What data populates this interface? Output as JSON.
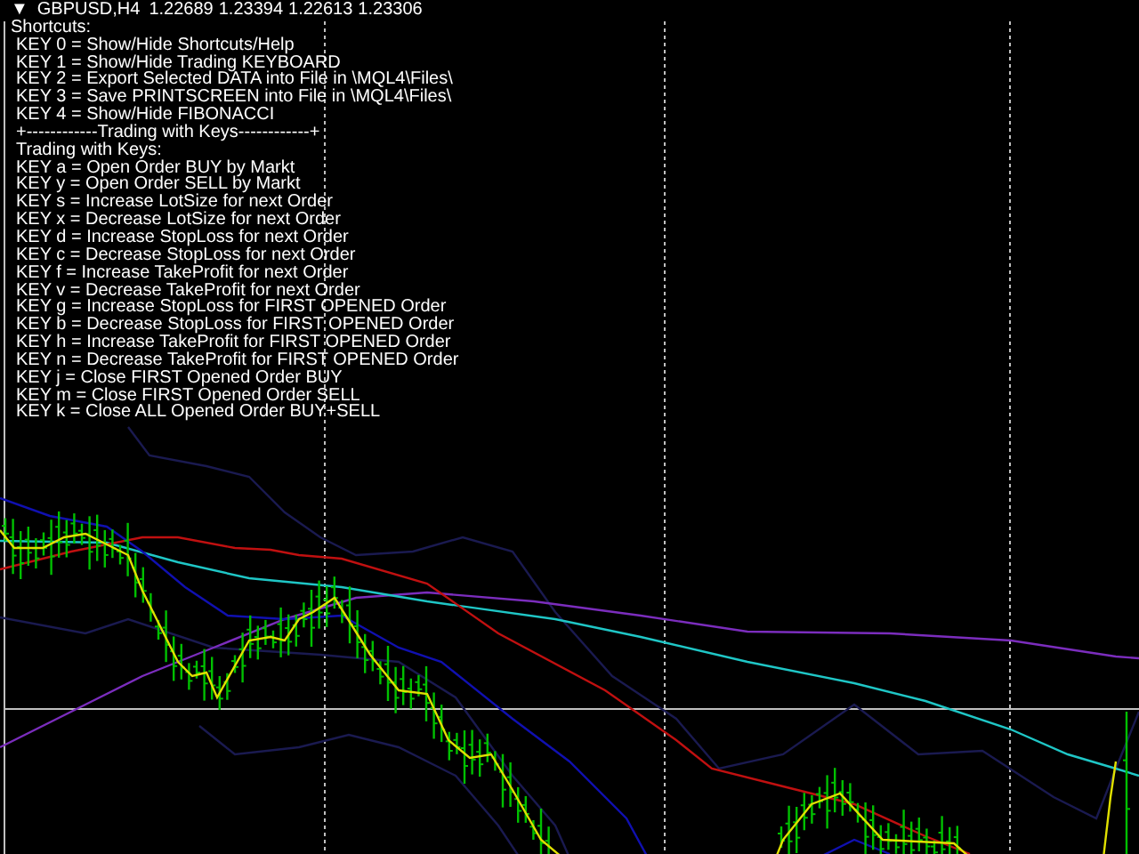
{
  "header": {
    "toggle": "▼",
    "symbol": "GBPUSD,H4",
    "prices": [
      "1.22689",
      "1.23394",
      "1.22613",
      "1.23306"
    ]
  },
  "help": {
    "title": "Shortcuts:",
    "lines": [
      "KEY 0 = Show/Hide Shortcuts/Help",
      "KEY 1 = Show/Hide Trading KEYBOARD",
      "KEY 2 = Export Selected DATA into File in \\MQL4\\Files\\",
      "KEY 3 = Save PRINTSCREEN into File in \\MQL4\\Files\\",
      "KEY 4 = Show/Hide FIBONACCI",
      "+------------Trading with Keys------------+",
      "Trading with Keys:",
      "KEY a = Open Order BUY by Markt",
      "KEY y = Open Order SELL by Markt",
      "KEY s = Increase LotSize for next Order",
      "KEY x = Decrease LotSize for next Order",
      "KEY d = Increase StopLoss for next Order",
      "KEY c = Decrease StopLoss for next Order",
      "KEY f =  Increase TakeProfit for next Order",
      "KEY v = Decrease TakeProfit for next Order",
      "KEY g = Increase StopLoss for FIRST OPENED Order",
      "KEY b = Decrease StopLoss for FIRST OPENED Order",
      "KEY h = Increase TakeProfit for FIRST OPENED Order",
      "KEY n = Decrease TakeProfit for FIRST OPENED Order",
      "KEY j = Close FIRST Opened Order BUY",
      "KEY m = Close FIRST Opened Order SELL",
      "KEY k = Close ALL Opened Order BUY+SELL"
    ]
  }
}
